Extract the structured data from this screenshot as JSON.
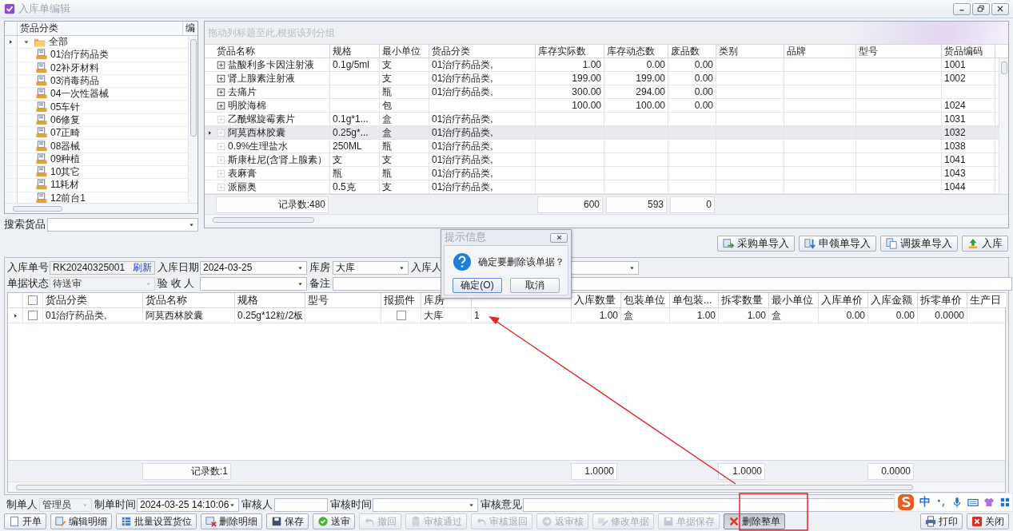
{
  "window": {
    "title": "入库单编辑"
  },
  "category_tree": {
    "columns": [
      "货品分类",
      "编"
    ],
    "nodes": [
      {
        "label": "全部",
        "expanded": true,
        "selected": true,
        "children": [
          {
            "label": "01治疗药品类",
            "selected": false
          },
          {
            "label": "02补牙材料",
            "selected": false
          },
          {
            "label": "03消毒药品",
            "selected": false
          },
          {
            "label": "04一次性器械",
            "selected": false
          },
          {
            "label": "05车针",
            "selected": false
          },
          {
            "label": "06修复",
            "selected": false
          },
          {
            "label": "07正畸",
            "selected": false
          },
          {
            "label": "08器械",
            "selected": false
          },
          {
            "label": "09种植",
            "selected": false
          },
          {
            "label": "10其它",
            "selected": false
          },
          {
            "label": "11耗材",
            "selected": false
          },
          {
            "label": "12前台1",
            "selected": false
          }
        ]
      }
    ]
  },
  "product_search": {
    "label": "搜索货品"
  },
  "product_grid": {
    "group_panel_hint": "拖动列标题至此,根据该列分组",
    "columns": [
      "货品名称",
      "规格",
      "最小单位",
      "货品分类",
      "库存实际数",
      "库存动态数",
      "废品数",
      "类别",
      "品牌",
      "型号",
      "货品编码"
    ],
    "rows": [
      {
        "expandable": true,
        "selected": false,
        "name": "盐酸利多卡因注射液",
        "spec": "0.1g/5ml",
        "min_unit": "支",
        "category": "01治疗药品类,",
        "stock_actual": "1.00",
        "stock_dynamic": "0.00",
        "waste": "0.00",
        "code": "1001"
      },
      {
        "expandable": true,
        "selected": false,
        "name": "肾上腺素注射液",
        "min_unit": "支",
        "category": "01治疗药品类,",
        "stock_actual": "199.00",
        "stock_dynamic": "199.00",
        "waste": "0.00",
        "code": "1002"
      },
      {
        "expandable": true,
        "selected": false,
        "name": "去痛片",
        "min_unit": "瓶",
        "category": "01治疗药品类,",
        "stock_actual": "300.00",
        "stock_dynamic": "294.00",
        "waste": "0.00"
      },
      {
        "expandable": true,
        "selected": false,
        "name": "明胶海棉",
        "min_unit": "包",
        "stock_actual": "100.00",
        "stock_dynamic": "100.00",
        "waste": "0.00",
        "code": "1024"
      },
      {
        "expandable": false,
        "selected": false,
        "name": "乙酰螺旋霉素片",
        "spec": "0.1g*1...",
        "min_unit": "盒",
        "category": "01治疗药品类,",
        "code": "1031"
      },
      {
        "expandable": false,
        "selected": true,
        "name": "阿莫西林胶囊",
        "spec": "0.25g*...",
        "min_unit": "盒",
        "category": "01治疗药品类,",
        "code": "1032"
      },
      {
        "expandable": false,
        "selected": false,
        "name": "0.9%生理盐水",
        "spec": "250ML",
        "min_unit": "瓶",
        "category": "01治疗药品类,",
        "code": "1038"
      },
      {
        "expandable": false,
        "selected": false,
        "name": "斯康杜尼(含肾上腺素）",
        "spec": "支",
        "min_unit": "支",
        "category": "01治疗药品类,",
        "code": "1041"
      },
      {
        "expandable": false,
        "selected": false,
        "name": "表麻膏",
        "spec": "瓶",
        "min_unit": "瓶",
        "category": "01治疗药品类,",
        "code": "1043"
      },
      {
        "expandable": false,
        "selected": false,
        "name": "派丽奥",
        "spec": "0.5克",
        "min_unit": "支",
        "category": "01治疗药品类,",
        "code": "1044"
      }
    ],
    "footer": {
      "name": "记录数:480",
      "stock_actual": "600",
      "stock_dynamic": "593",
      "waste": "0"
    }
  },
  "import_buttons": [
    {
      "label": "采购单导入"
    },
    {
      "label": "申领单导入"
    },
    {
      "label": "调拨单导入"
    },
    {
      "label": "入库"
    }
  ],
  "form": {
    "rows": [
      {
        "fields": [
          {
            "label": "入库单号",
            "kind": "text",
            "value": "RK20240325001",
            "link": "刷新",
            "disabled": false
          },
          {
            "label": "入库日期",
            "kind": "combo",
            "value": "2024-03-25",
            "disabled": false
          },
          {
            "label": "库房",
            "kind": "combo",
            "value": "大库",
            "disabled": false
          },
          {
            "label": "入库人",
            "kind": "combo",
            "disabled": false
          }
        ]
      },
      {
        "fields": [
          {
            "label": "单据状态",
            "kind": "combo",
            "value": "待送审",
            "disabled": true
          },
          {
            "label": "验 收 人",
            "kind": "combo",
            "disabled": false
          },
          {
            "label": "备注",
            "kind": "text",
            "disabled": false
          }
        ]
      }
    ]
  },
  "detail_grid": {
    "header_checkbox": {
      "checked": false
    },
    "columns": [
      "货品分类",
      "货品名称",
      "规格",
      "型号",
      "报损件",
      "库房",
      null,
      "入库数量",
      "包装单位",
      "单包装...",
      "拆零数量",
      "最小单位",
      "入库单价",
      "入库金额",
      "拆零单价",
      "生产日"
    ],
    "rows": [
      {
        "selected": true,
        "checked": false,
        "category": "01治疗药品类,",
        "name": "阿莫西林胶囊",
        "spec": "0.25g*12粒/2板",
        "damaged": false,
        "warehouse": "大库",
        "column_7": "1",
        "quantity": "1.00",
        "package_unit": "盒",
        "per_package": "1.00",
        "loose_quantity": "1.00",
        "min_unit": "盒",
        "unit_price": "0.00",
        "amount": "0.00",
        "loose_price": "0.0000"
      }
    ],
    "footer": {
      "name": "记录数:1",
      "quantity": "1.0000",
      "loose_quantity": "1.0000",
      "amount": "0.0000"
    }
  },
  "info_bar": {
    "fields": [
      {
        "label": "制单人",
        "kind": "combo",
        "value": "管理员",
        "disabled": true
      },
      {
        "label": "制单时间",
        "kind": "combo",
        "value": "2024-03-25 14:10:06",
        "disabled": false
      },
      {
        "label": "审核人",
        "kind": "text",
        "disabled": false
      },
      {
        "label": "审核时间",
        "kind": "combo",
        "disabled": false
      },
      {
        "label": "审核意见",
        "kind": "text",
        "disabled": false
      }
    ]
  },
  "action_buttons": [
    {
      "label": "开单",
      "disabled": false,
      "pressed": false
    },
    {
      "label": "编辑明细",
      "disabled": false,
      "pressed": false
    },
    {
      "label": "批量设置货位",
      "disabled": false,
      "pressed": false
    },
    {
      "label": "删除明细",
      "disabled": false,
      "pressed": false
    },
    {
      "label": "保存",
      "disabled": false,
      "pressed": false
    },
    {
      "label": "送审",
      "disabled": false,
      "pressed": false
    },
    {
      "label": "撤回",
      "disabled": true,
      "pressed": false
    },
    {
      "label": "审核通过",
      "disabled": true,
      "pressed": false
    },
    {
      "label": "审核退回",
      "disabled": true,
      "pressed": false
    },
    {
      "label": "返审核",
      "disabled": true,
      "pressed": false
    },
    {
      "label": "修改单据",
      "disabled": true,
      "pressed": false
    },
    {
      "label": "单据保存",
      "disabled": true,
      "pressed": false
    },
    {
      "label": "删除整单",
      "disabled": false,
      "pressed": true
    }
  ],
  "right_buttons": [
    {
      "label": "打印"
    },
    {
      "label": "关闭"
    }
  ],
  "dialog": {
    "title": "提示信息",
    "message": "确定要删除该单据？",
    "buttons": [
      {
        "label": "确定(O)",
        "default": true
      },
      {
        "label": "取消",
        "default": false
      }
    ]
  },
  "ime_toolbar": {
    "mode": "中"
  }
}
